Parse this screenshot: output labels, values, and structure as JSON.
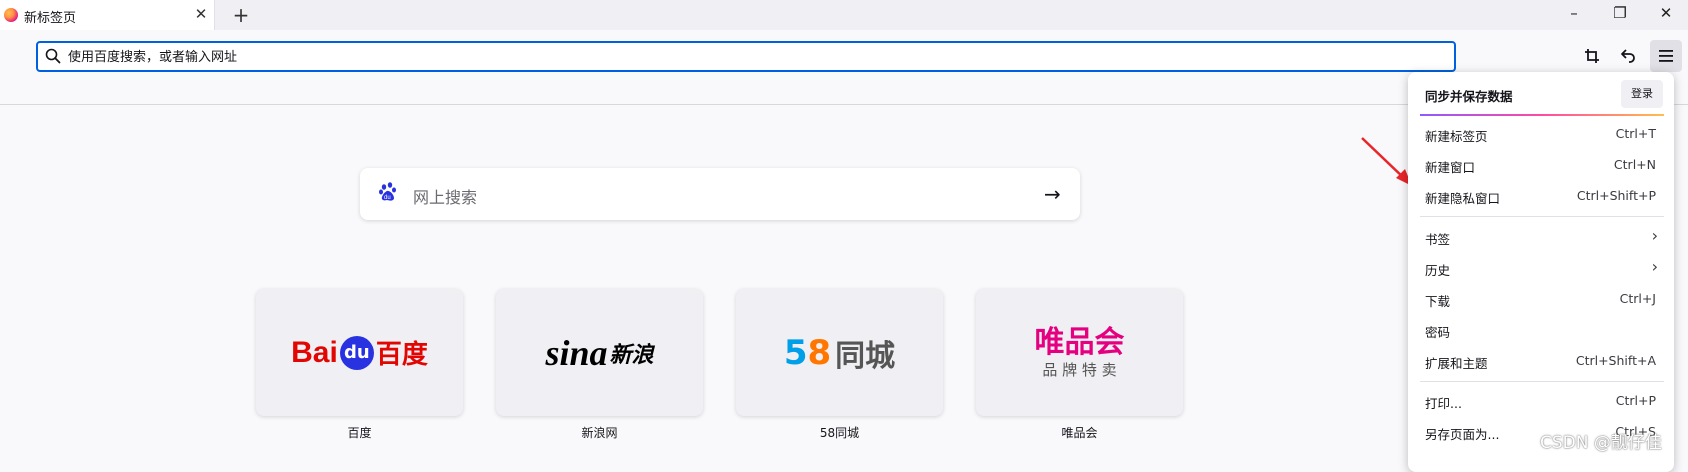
{
  "tab": {
    "title": "新标签页",
    "close": "✕"
  },
  "newtab": "+",
  "window": {
    "minimize": "–",
    "restore": "❐",
    "close": "✕"
  },
  "urlbar": {
    "placeholder": "使用百度搜索，或者输入网址"
  },
  "search": {
    "placeholder": "网上搜索"
  },
  "tiles": [
    {
      "label": "百度"
    },
    {
      "label": "新浪网"
    },
    {
      "label": "58同城"
    },
    {
      "label": "唯品会"
    }
  ],
  "logos": {
    "baidu_bai": "Bai",
    "baidu_du": "du",
    "baidu_cn": "百度",
    "sina": "sina",
    "sina_cn": "新浪",
    "t58_num5": "5",
    "t58_num8": "8",
    "t58_cn": "同城",
    "vip_main": "唯品会",
    "vip_sub": "品 牌 特 卖"
  },
  "menu": {
    "sync": "同步并保存数据",
    "login": "登录",
    "items": [
      {
        "label": "新建标签页",
        "shortcut": "Ctrl+T"
      },
      {
        "label": "新建窗口",
        "shortcut": "Ctrl+N"
      },
      {
        "label": "新建隐私窗口",
        "shortcut": "Ctrl+Shift+P"
      },
      {
        "label": "书签",
        "shortcut": ""
      },
      {
        "label": "历史",
        "shortcut": ""
      },
      {
        "label": "下载",
        "shortcut": "Ctrl+J"
      },
      {
        "label": "密码",
        "shortcut": ""
      },
      {
        "label": "扩展和主题",
        "shortcut": "Ctrl+Shift+A"
      },
      {
        "label": "打印...",
        "shortcut": "Ctrl+P"
      },
      {
        "label": "另存页面为...",
        "shortcut": "Ctrl+S"
      }
    ]
  },
  "watermark": "CSDN @靓仔佳",
  "colors": {
    "accent": "#0061e0",
    "arrow": "#e8262a"
  }
}
